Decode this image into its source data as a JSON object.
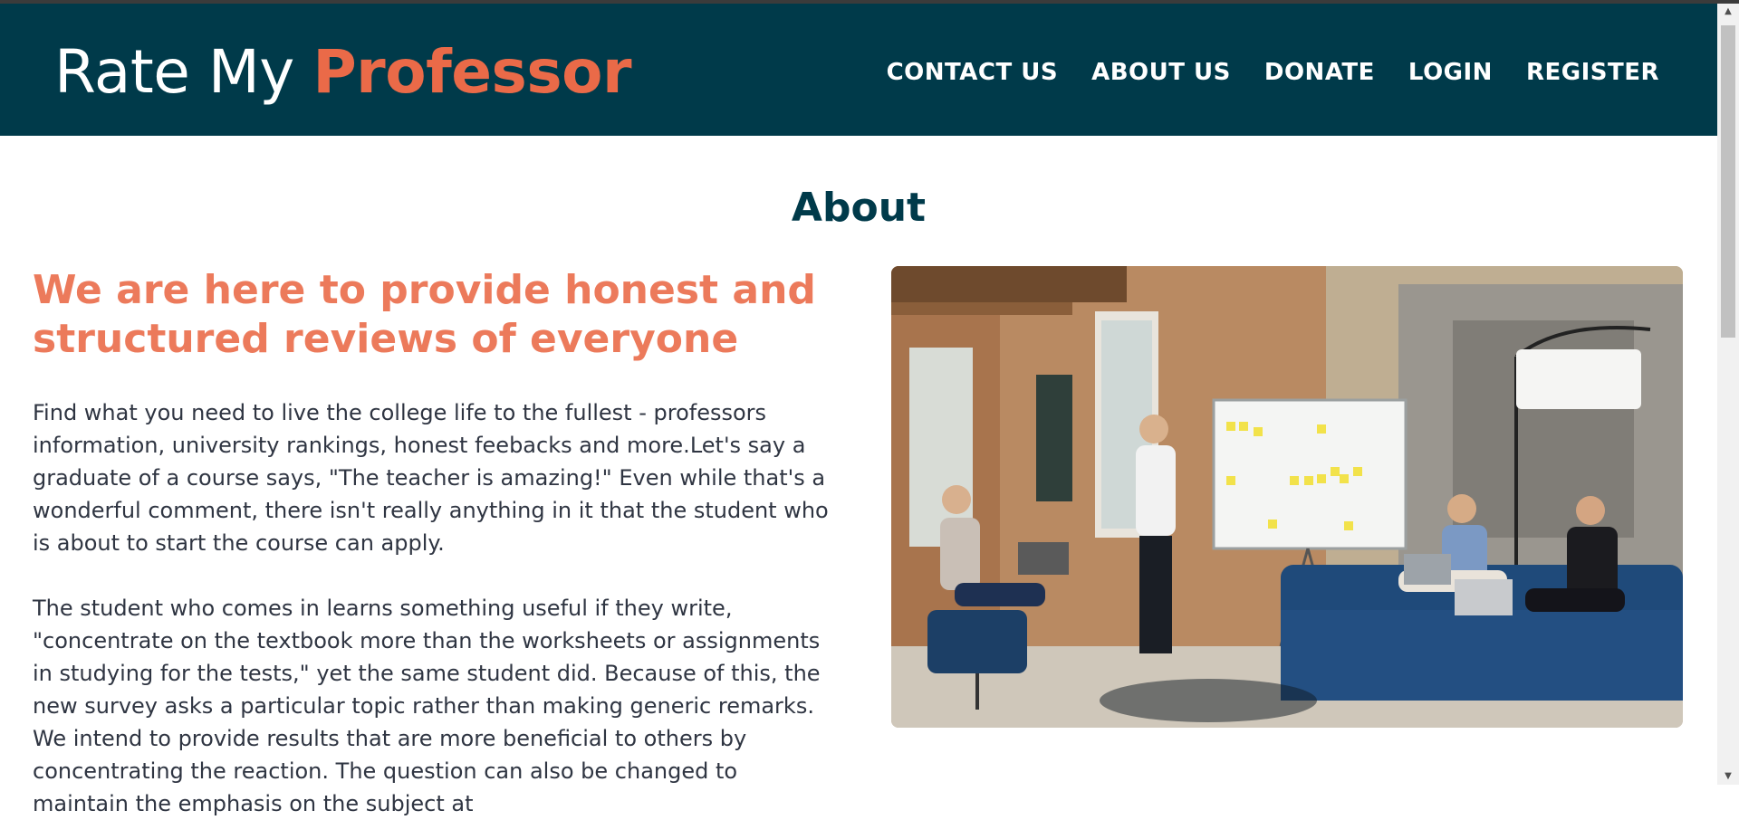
{
  "header": {
    "brand_part1": "Rate My ",
    "brand_part2": "Professor",
    "nav": [
      "CONTACT US",
      "ABOUT US",
      "DONATE",
      "LOGIN",
      "REGISTER"
    ]
  },
  "main": {
    "title": "About",
    "headline": "We are here to provide honest and structured reviews of everyone",
    "paragraph1": "Find what you need to live the college life to the fullest - professors information, university rankings, honest feebacks and more.Let's say a graduate of a course says, \"The teacher is amazing!\" Even while that's a wonderful comment, there isn't really anything in it that the student who is about to start the course can apply.",
    "paragraph2": "The student who comes in learns something useful if they write, \"concentrate on the textbook more than the worksheets or assignments in studying for the tests,\" yet the same student did. Because of this, the new survey asks a particular topic rather than making generic remarks. We intend to provide results that are more beneficial to others by concentrating the reaction. The question can also be changed to maintain the emphasis on the subject at"
  },
  "colors": {
    "navbar": "#003a4a",
    "accent": "#ea6a48",
    "headline": "#ec7a5b",
    "title": "#003a4a"
  },
  "icons": {
    "scroll_up": "chevron-up-icon",
    "scroll_down": "chevron-down-icon"
  }
}
